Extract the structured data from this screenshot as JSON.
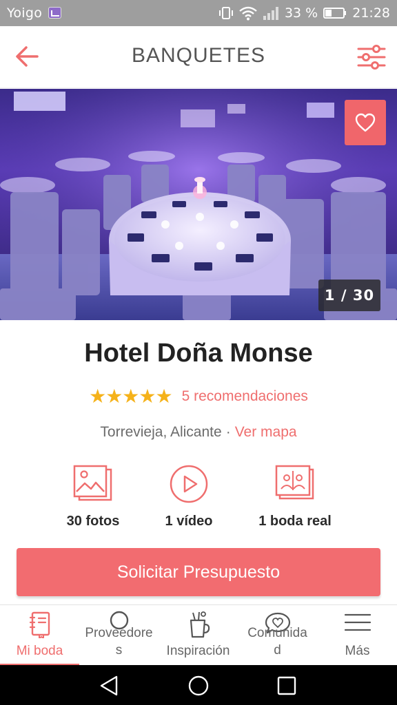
{
  "status_bar": {
    "carrier": "Yoigo",
    "battery": "33 %",
    "time": "21:28"
  },
  "header": {
    "title": "BANQUETES",
    "back_icon": "arrow-left-icon",
    "filter_icon": "sliders-icon"
  },
  "gallery": {
    "counter": "1 / 30",
    "favorite_icon": "heart-outline-icon"
  },
  "venue": {
    "name": "Hotel Doña Monse",
    "stars": "★★★★★",
    "rating": 5,
    "recommendations": "5 recomendaciones",
    "location": "Torrevieja, Alicante",
    "separator": "·",
    "map_link": "Ver mapa"
  },
  "media": [
    {
      "label": "30 fotos",
      "icon": "photo-gallery-icon"
    },
    {
      "label": "1 vídeo",
      "icon": "play-circle-icon"
    },
    {
      "label": "1 boda real",
      "icon": "wedding-album-icon"
    }
  ],
  "cta": {
    "label": "Solicitar Presupuesto"
  },
  "bottom_nav": {
    "items": [
      {
        "line1": "Mi boda",
        "line2": "",
        "icon": "notebook-icon",
        "active": true
      },
      {
        "line1": "Proveedore",
        "line2": "s",
        "icon": "search-icon",
        "active": false
      },
      {
        "line1": "Inspiración",
        "line2": "",
        "icon": "inspiration-cup-icon",
        "active": false
      },
      {
        "line1": "Comunida",
        "line2": "d",
        "icon": "chat-heart-icon",
        "active": false
      },
      {
        "line1": "Más",
        "line2": "",
        "icon": "menu-icon",
        "active": false
      }
    ]
  },
  "colors": {
    "accent": "#EF6E6E",
    "status_bar": "#9E9E9E",
    "star": "#F5B21A"
  }
}
